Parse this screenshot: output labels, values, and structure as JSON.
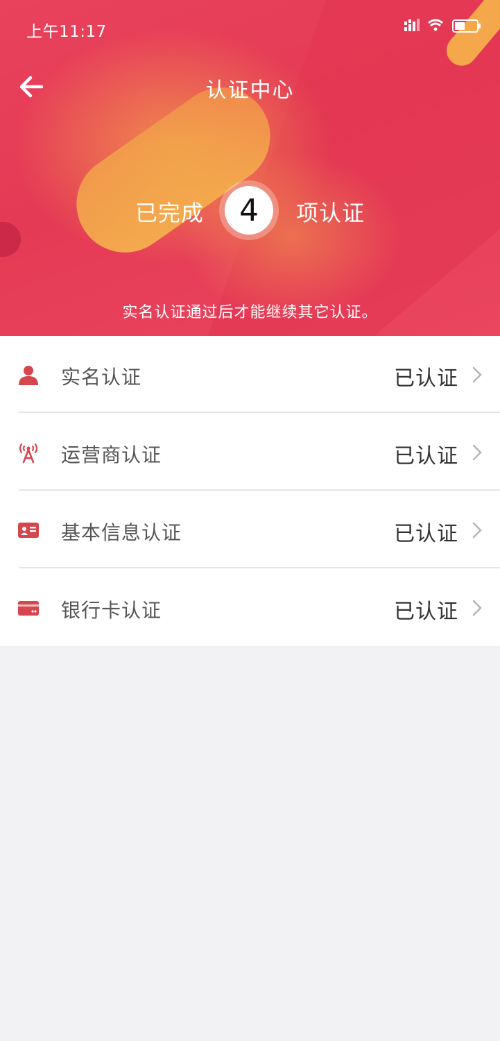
{
  "status_bar": {
    "time": "上午11:17",
    "icons": [
      "signal-icon",
      "wifi-icon",
      "battery-icon"
    ]
  },
  "nav": {
    "title": "认证中心",
    "back_icon": "arrow-left-icon"
  },
  "summary": {
    "prefix": "已完成",
    "count": "4",
    "suffix": "项认证",
    "hint": "实名认证通过后才能继续其它认证。"
  },
  "colors": {
    "header": "#e53a55",
    "accent_yellow": "#f7c948",
    "icon_red": "#d6474d",
    "background": "#f2f1f4"
  },
  "items": [
    {
      "label": "实名认证",
      "status": "已认证",
      "icon": "person-icon"
    },
    {
      "label": "运营商认证",
      "status": "已认证",
      "icon": "signal-tower-icon"
    },
    {
      "label": "基本信息认证",
      "status": "已认证",
      "icon": "id-card-icon"
    },
    {
      "label": "银行卡认证",
      "status": "已认证",
      "icon": "bank-card-icon"
    }
  ]
}
